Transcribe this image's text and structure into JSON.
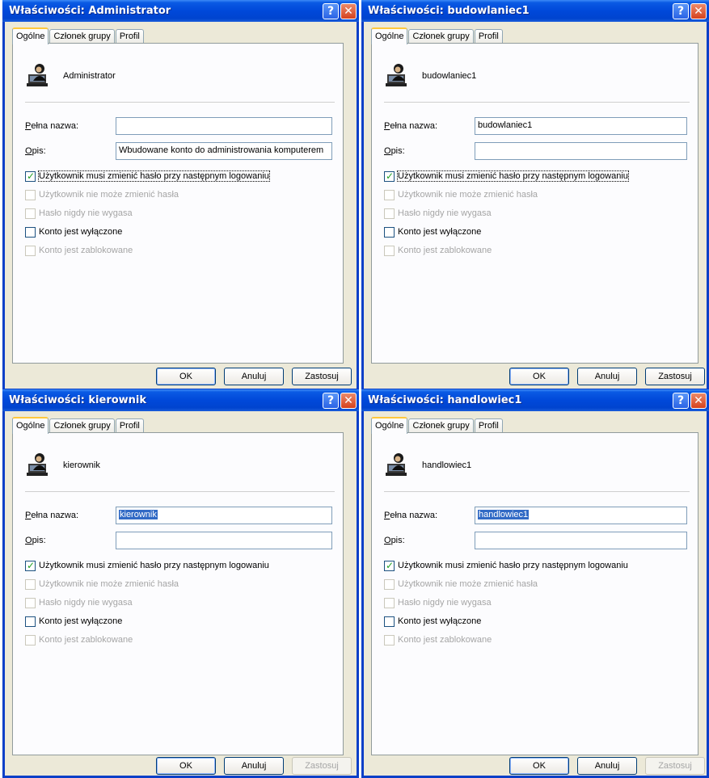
{
  "dialogs": [
    {
      "title": "Właściwości: Administrator",
      "tabs": [
        "Ogólne",
        "Członek grupy",
        "Profil"
      ],
      "user_name": "Administrator",
      "full_name_label": "Pełna nazwa:",
      "full_name_value": "",
      "description_label": "Opis:",
      "description_value": "Wbudowane konto do administrowania komputerem",
      "checkboxes": [
        {
          "label": "Użytkownik musi zmienić hasło przy następnym logowaniu",
          "checked": true,
          "enabled": true
        },
        {
          "label": "Użytkownik nie może zmienić hasła",
          "checked": false,
          "enabled": false
        },
        {
          "label": "Hasło nigdy nie wygasa",
          "checked": false,
          "enabled": false
        },
        {
          "label": "Konto jest wyłączone",
          "checked": false,
          "enabled": true
        },
        {
          "label": "Konto jest zablokowane",
          "checked": false,
          "enabled": false
        }
      ],
      "buttons": {
        "ok": "OK",
        "cancel": "Anuluj",
        "apply": "Zastosuj"
      }
    },
    {
      "title": "Właściwości: budowlaniec1",
      "tabs": [
        "Ogólne",
        "Członek grupy",
        "Profil"
      ],
      "user_name": "budowlaniec1",
      "full_name_label": "Pełna nazwa:",
      "full_name_value": "budowlaniec1",
      "description_label": "Opis:",
      "description_value": "",
      "checkboxes": [
        {
          "label": "Użytkownik musi zmienić hasło przy następnym logowaniu",
          "checked": true,
          "enabled": true
        },
        {
          "label": "Użytkownik nie może zmienić hasła",
          "checked": false,
          "enabled": false
        },
        {
          "label": "Hasło nigdy nie wygasa",
          "checked": false,
          "enabled": false
        },
        {
          "label": "Konto jest wyłączone",
          "checked": false,
          "enabled": true
        },
        {
          "label": "Konto jest zablokowane",
          "checked": false,
          "enabled": false
        }
      ],
      "buttons": {
        "ok": "OK",
        "cancel": "Anuluj",
        "apply": "Zastosuj"
      }
    },
    {
      "title": "Właściwości: kierownik",
      "tabs": [
        "Ogólne",
        "Członek grupy",
        "Profil"
      ],
      "user_name": "kierownik",
      "full_name_label": "Pełna nazwa:",
      "full_name_value": "kierownik",
      "description_label": "Opis:",
      "description_value": "",
      "checkboxes": [
        {
          "label": "Użytkownik musi zmienić hasło przy następnym logowaniu",
          "checked": true,
          "enabled": true
        },
        {
          "label": "Użytkownik nie może zmienić hasła",
          "checked": false,
          "enabled": false
        },
        {
          "label": "Hasło nigdy nie wygasa",
          "checked": false,
          "enabled": false
        },
        {
          "label": "Konto jest wyłączone",
          "checked": false,
          "enabled": true
        },
        {
          "label": "Konto jest zablokowane",
          "checked": false,
          "enabled": false
        }
      ],
      "buttons": {
        "ok": "OK",
        "cancel": "Anuluj",
        "apply": "Zastosuj"
      }
    },
    {
      "title": "Właściwości: handlowiec1",
      "tabs": [
        "Ogólne",
        "Członek grupy",
        "Profil"
      ],
      "user_name": "handlowiec1",
      "full_name_label": "Pełna nazwa:",
      "full_name_value": "handlowiec1",
      "description_label": "Opis:",
      "description_value": "",
      "checkboxes": [
        {
          "label": "Użytkownik musi zmienić hasło przy następnym logowaniu",
          "checked": true,
          "enabled": true
        },
        {
          "label": "Użytkownik nie może zmienić hasła",
          "checked": false,
          "enabled": false
        },
        {
          "label": "Hasło nigdy nie wygasa",
          "checked": false,
          "enabled": false
        },
        {
          "label": "Konto jest wyłączone",
          "checked": false,
          "enabled": true
        },
        {
          "label": "Konto jest zablokowane",
          "checked": false,
          "enabled": false
        }
      ],
      "buttons": {
        "ok": "OK",
        "cancel": "Anuluj",
        "apply": "Zastosuj"
      }
    }
  ],
  "icons": {
    "title_help": "?",
    "title_close": "✕",
    "user_icon": "user-computer-icon"
  }
}
